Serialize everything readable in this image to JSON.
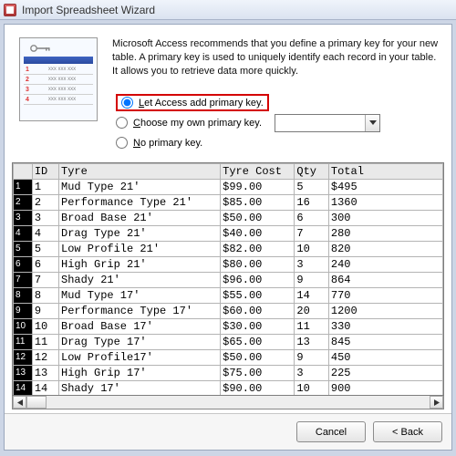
{
  "window": {
    "title": "Import Spreadsheet Wizard"
  },
  "explain": "Microsoft Access recommends that you define a primary key for your new table. A primary key is used to uniquely identify each record in your table. It allows you to retrieve data more quickly.",
  "radio": {
    "let_access": {
      "prefix": "L",
      "rest": "et Access add primary key."
    },
    "choose_own": {
      "prefix": "C",
      "rest": "hoose my own primary key."
    },
    "none": {
      "prefix": "N",
      "rest": "o primary key."
    }
  },
  "illus_rows": [
    "1",
    "2",
    "3",
    "4"
  ],
  "illus_cells": "xxx xxx xxx",
  "grid": {
    "columns": [
      "ID",
      "Tyre",
      "Tyre Cost",
      "Qty",
      "Total"
    ],
    "rows": [
      {
        "n": "1",
        "id": "1",
        "tyre": "Mud Type 21'",
        "cost": "$99.00",
        "qty": "5",
        "total": "$495"
      },
      {
        "n": "2",
        "id": "2",
        "tyre": "Performance Type 21'",
        "cost": "$85.00",
        "qty": "16",
        "total": "1360"
      },
      {
        "n": "3",
        "id": "3",
        "tyre": "Broad Base 21'",
        "cost": "$50.00",
        "qty": "6",
        "total": "300"
      },
      {
        "n": "4",
        "id": "4",
        "tyre": "Drag Type 21'",
        "cost": "$40.00",
        "qty": "7",
        "total": "280"
      },
      {
        "n": "5",
        "id": "5",
        "tyre": "Low Profile 21'",
        "cost": "$82.00",
        "qty": "10",
        "total": "820"
      },
      {
        "n": "6",
        "id": "6",
        "tyre": "High Grip 21'",
        "cost": "$80.00",
        "qty": "3",
        "total": "240"
      },
      {
        "n": "7",
        "id": "7",
        "tyre": "Shady 21'",
        "cost": "$96.00",
        "qty": "9",
        "total": "864"
      },
      {
        "n": "8",
        "id": "8",
        "tyre": "Mud Type 17'",
        "cost": "$55.00",
        "qty": "14",
        "total": "770"
      },
      {
        "n": "9",
        "id": "9",
        "tyre": "Performance Type 17'",
        "cost": "$60.00",
        "qty": "20",
        "total": "1200"
      },
      {
        "n": "10",
        "id": "10",
        "tyre": "Broad Base 17'",
        "cost": "$30.00",
        "qty": "11",
        "total": "330"
      },
      {
        "n": "11",
        "id": "11",
        "tyre": "Drag Type 17'",
        "cost": "$65.00",
        "qty": "13",
        "total": "845"
      },
      {
        "n": "12",
        "id": "12",
        "tyre": "Low Profile17'",
        "cost": "$50.00",
        "qty": "9",
        "total": "450"
      },
      {
        "n": "13",
        "id": "13",
        "tyre": "High Grip 17'",
        "cost": "$75.00",
        "qty": "3",
        "total": "225"
      },
      {
        "n": "14",
        "id": "14",
        "tyre": "Shady 17'",
        "cost": "$90.00",
        "qty": "10",
        "total": "900"
      }
    ]
  },
  "buttons": {
    "cancel": "Cancel",
    "back": "< Back"
  }
}
